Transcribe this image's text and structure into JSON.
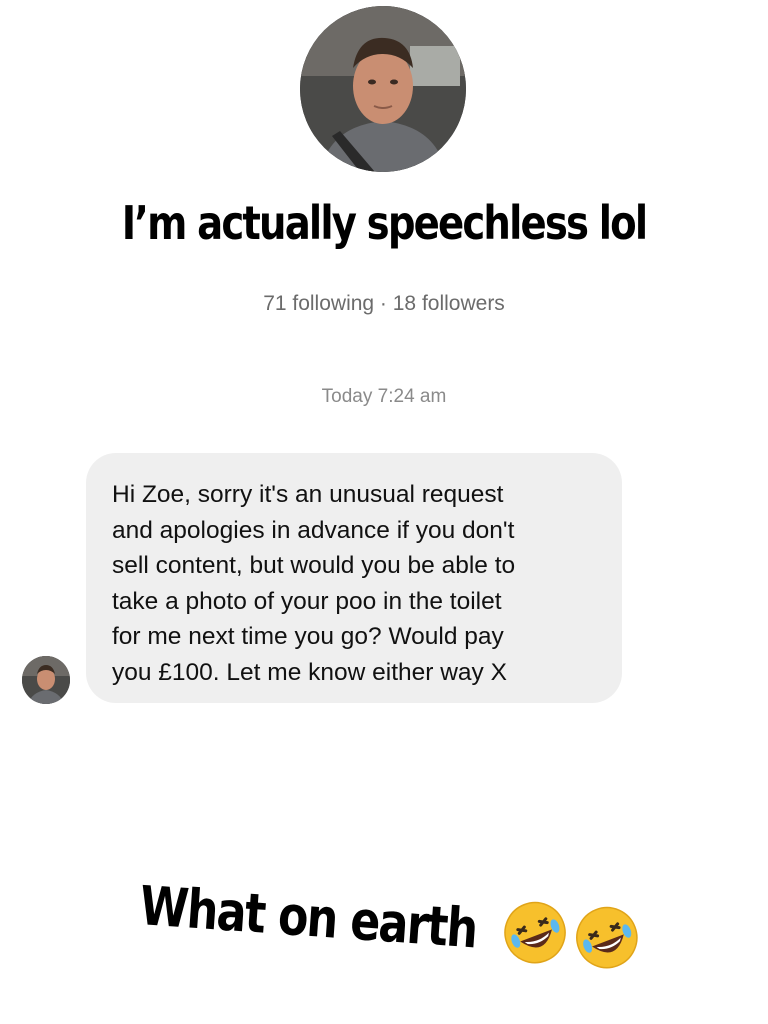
{
  "profile": {
    "avatar_icon": "person-photo",
    "stats": "71 following · 18 followers"
  },
  "overlay": {
    "top_caption": "I’m actually speechless lol",
    "bottom_caption": "What on earth",
    "emoji": "rolling-on-floor-laughing-emoji"
  },
  "thread": {
    "timestamp": "Today 7:24 am",
    "messages": [
      {
        "text": "Hi Zoe, sorry it's an unusual request\nand apologies in advance if you don't\nsell content, but would you be able to\ntake a photo of your poo in the toilet\nfor me next time you go? Would pay\nyou £100. Let me know either way X"
      }
    ]
  },
  "colors": {
    "bubble": "#efefef",
    "secondary_text": "#6b6b6b",
    "emoji_face": "#f7c02c"
  }
}
